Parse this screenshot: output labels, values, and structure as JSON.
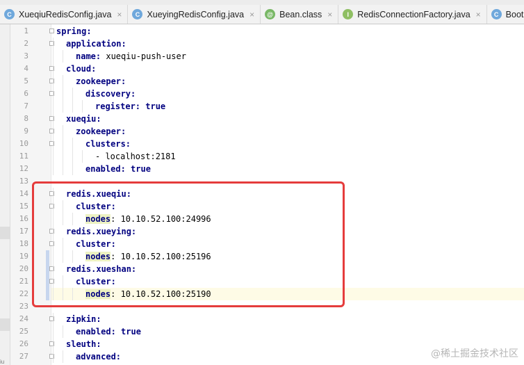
{
  "tabs": [
    {
      "label": "XueqiuRedisConfig.java",
      "icon": "class-icon",
      "glyph": "C",
      "close": "×"
    },
    {
      "label": "XueyingRedisConfig.java",
      "icon": "class-icon",
      "glyph": "C",
      "close": "×"
    },
    {
      "label": "Bean.class",
      "icon": "annotation-icon",
      "glyph": "@",
      "close": "×"
    },
    {
      "label": "RedisConnectionFactory.java",
      "icon": "interface-icon",
      "glyph": "I",
      "close": "×"
    },
    {
      "label": "BootstrapTe",
      "icon": "class-icon",
      "glyph": "C",
      "close": ""
    }
  ],
  "editor": {
    "current_line": 22,
    "lines": [
      {
        "n": "1",
        "indent": 0,
        "key": "spring:",
        "value": ""
      },
      {
        "n": "2",
        "indent": 1,
        "key": "application:",
        "value": ""
      },
      {
        "n": "3",
        "indent": 2,
        "key": "name:",
        "value": " xueqiu-push-user"
      },
      {
        "n": "4",
        "indent": 1,
        "key": "cloud:",
        "value": ""
      },
      {
        "n": "5",
        "indent": 2,
        "key": "zookeeper:",
        "value": ""
      },
      {
        "n": "6",
        "indent": 3,
        "key": "discovery:",
        "value": ""
      },
      {
        "n": "7",
        "indent": 4,
        "key": "register:",
        "value": " true",
        "bool": true
      },
      {
        "n": "8",
        "indent": 1,
        "key": "xueqiu:",
        "value": ""
      },
      {
        "n": "9",
        "indent": 2,
        "key": "zookeeper:",
        "value": ""
      },
      {
        "n": "10",
        "indent": 3,
        "key": "clusters:",
        "value": ""
      },
      {
        "n": "11",
        "indent": 4,
        "key": "",
        "value": "- localhost:2181"
      },
      {
        "n": "12",
        "indent": 3,
        "key": "enabled:",
        "value": " true",
        "bool": true
      },
      {
        "n": "13",
        "indent": 0,
        "key": "",
        "value": ""
      },
      {
        "n": "14",
        "indent": 1,
        "key": "redis.xueqiu:",
        "value": ""
      },
      {
        "n": "15",
        "indent": 2,
        "key": "cluster:",
        "value": ""
      },
      {
        "n": "16",
        "indent": 3,
        "key": "nodes",
        "value": ": 10.10.52.100:24996",
        "hl": true
      },
      {
        "n": "17",
        "indent": 1,
        "key": "redis.xueying:",
        "value": ""
      },
      {
        "n": "18",
        "indent": 2,
        "key": "cluster:",
        "value": ""
      },
      {
        "n": "19",
        "indent": 3,
        "key": "nodes",
        "value": ": 10.10.52.100:25196",
        "hl": true
      },
      {
        "n": "20",
        "indent": 1,
        "key": "redis.xueshan:",
        "value": ""
      },
      {
        "n": "21",
        "indent": 2,
        "key": "cluster:",
        "value": ""
      },
      {
        "n": "22",
        "indent": 3,
        "key": "nodes",
        "value": ": 10.10.52.100:25190",
        "hl": true
      },
      {
        "n": "23",
        "indent": 0,
        "key": "",
        "value": ""
      },
      {
        "n": "24",
        "indent": 1,
        "key": "zipkin:",
        "value": ""
      },
      {
        "n": "25",
        "indent": 2,
        "key": "enabled:",
        "value": " true",
        "bool": true
      },
      {
        "n": "26",
        "indent": 1,
        "key": "sleuth:",
        "value": ""
      },
      {
        "n": "27",
        "indent": 2,
        "key": "advanced:",
        "value": ""
      }
    ]
  },
  "sidebar_fragment": "iu",
  "watermark": "@稀土掘金技术社区",
  "colors": {
    "key": "#000080",
    "highlight_box": "#e53c3c",
    "current_line": "#fefbe6"
  }
}
